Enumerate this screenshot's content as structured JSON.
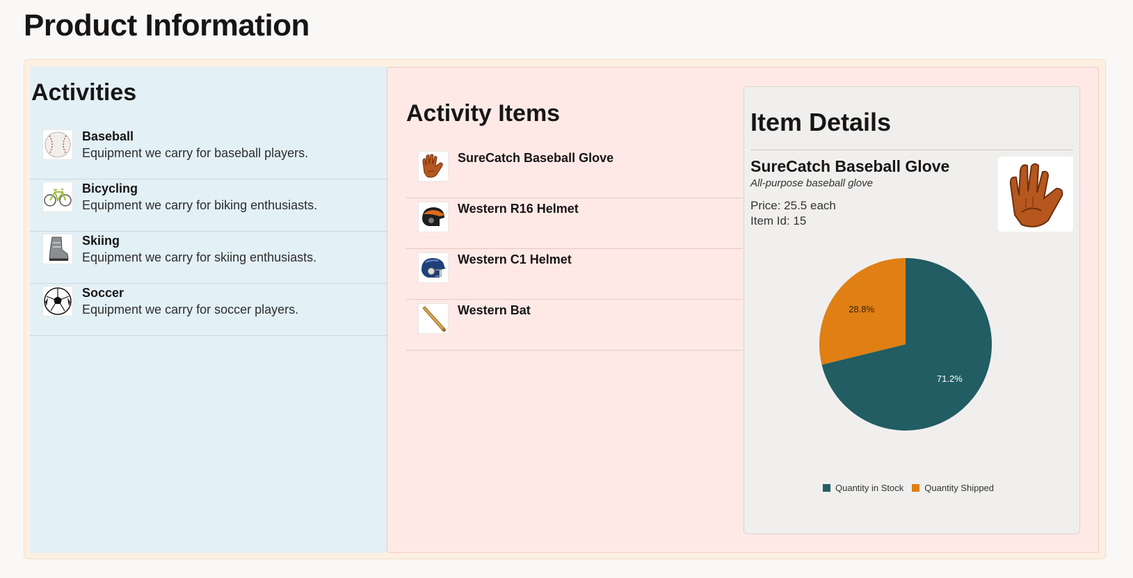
{
  "page": {
    "title": "Product Information"
  },
  "activities": {
    "heading": "Activities",
    "items": [
      {
        "name": "Baseball",
        "description": "Equipment we carry for baseball players.",
        "icon": "baseball-icon"
      },
      {
        "name": "Bicycling",
        "description": "Equipment we carry for biking enthusiasts.",
        "icon": "bicycle-icon"
      },
      {
        "name": "Skiing",
        "description": "Equipment we carry for skiing enthusiasts.",
        "icon": "ski-boot-icon"
      },
      {
        "name": "Soccer",
        "description": "Equipment we carry for soccer players.",
        "icon": "soccer-ball-icon"
      }
    ]
  },
  "activity_items": {
    "heading": "Activity Items",
    "items": [
      {
        "name": "SureCatch Baseball Glove",
        "icon": "glove-icon"
      },
      {
        "name": "Western R16 Helmet",
        "icon": "helmet-orange-icon"
      },
      {
        "name": "Western C1 Helmet",
        "icon": "helmet-blue-icon"
      },
      {
        "name": "Western Bat",
        "icon": "bat-icon"
      }
    ]
  },
  "item_details": {
    "heading": "Item Details",
    "name": "SureCatch Baseball Glove",
    "description": "All-purpose baseball glove",
    "price": "Price: 25.5 each",
    "item_id": "Item Id: 15",
    "image_icon": "glove-icon"
  },
  "chart_data": {
    "type": "pie",
    "slices": [
      {
        "label": "Quantity in Stock",
        "value": 71.2,
        "display": "71.2%",
        "color": "#215d63"
      },
      {
        "label": "Quantity Shipped",
        "value": 28.8,
        "display": "28.8%",
        "color": "#df7f14"
      }
    ],
    "legend_position": "bottom"
  }
}
